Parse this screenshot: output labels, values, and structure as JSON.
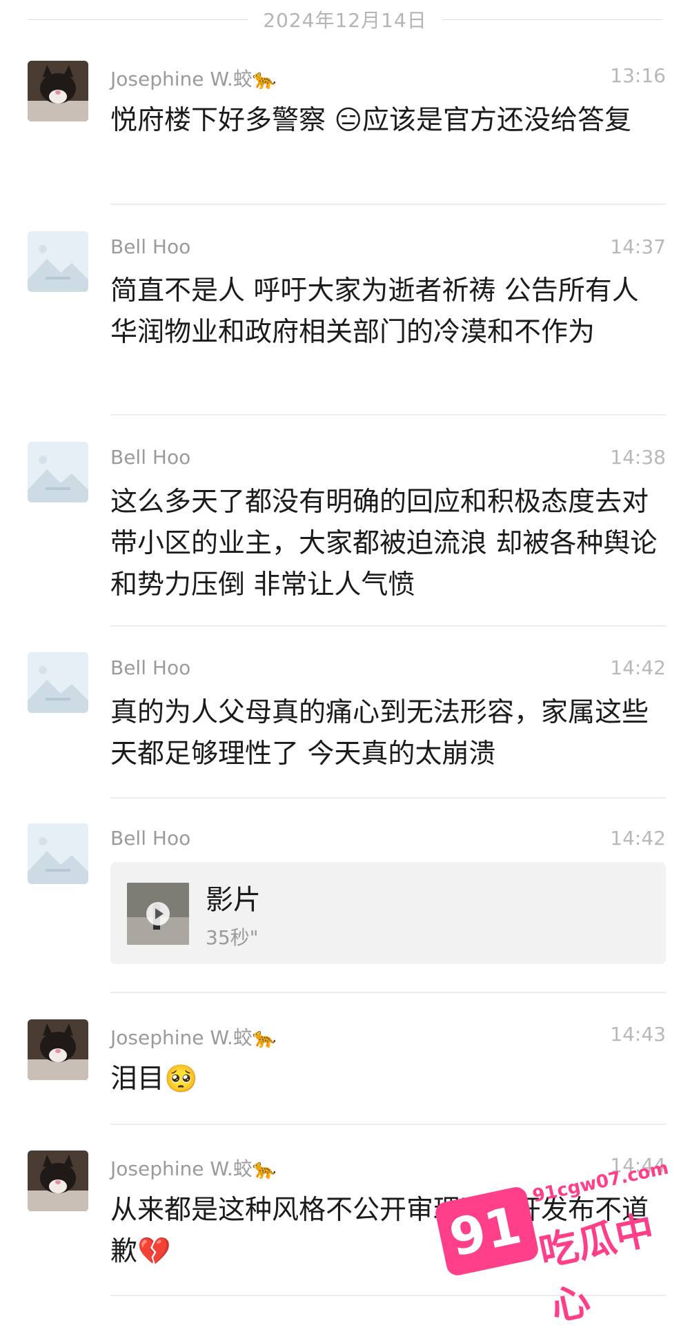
{
  "date_separator": "2024年12月14日",
  "messages": [
    {
      "author": "Josephine W.蛟🐆",
      "time": "13:16",
      "text": "悦府楼下好多警察 😑应该是官方还没给答复"
    },
    {
      "author": "Bell Hoo",
      "time": "14:37",
      "text": "简直不是人 呼吁大家为逝者祈祷 公告所有人 华润物业和政府相关部门的冷漠和不作为"
    },
    {
      "author": "Bell Hoo",
      "time": "14:38",
      "text": "这么多天了都没有明确的回应和积极态度去对带小区的业主，大家都被迫流浪 却被各种舆论和势力压倒 非常让人气愤"
    },
    {
      "author": "Bell Hoo",
      "time": "14:42",
      "text": "真的为人父母真的痛心到无法形容，家属这些天都足够理性了 今天真的太崩溃"
    },
    {
      "author": "Bell Hoo",
      "time": "14:42",
      "video_title": "影片",
      "video_duration": "35秒\""
    },
    {
      "author": "Josephine W.蛟🐆",
      "time": "14:43",
      "text": "泪目🥺"
    },
    {
      "author": "Josephine W.蛟🐆",
      "time": "14:44",
      "text": "从来都是这种风格不公开审理不公开发布不道歉💔"
    }
  ],
  "watermark": {
    "number": "91",
    "text": "吃瓜中心",
    "url": "91cgw07.com"
  },
  "icons": {
    "avatar_cat": "cat-avatar",
    "avatar_placeholder": "placeholder-avatar",
    "play": "play-icon"
  }
}
